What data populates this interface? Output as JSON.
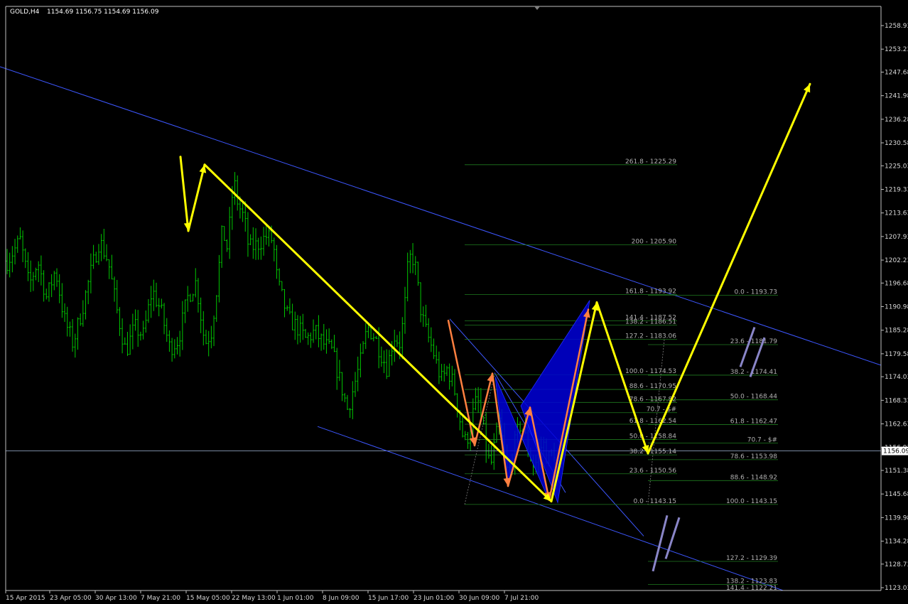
{
  "window": {
    "title": "GOLD,H4",
    "ohlc": "1154.69 1156.75 1154.69 1156.09"
  },
  "colors": {
    "background": "#000000",
    "candle": "#00c800",
    "trendline": "#3d57ff",
    "projection": "#ffff00",
    "harmonic": "#ff8040",
    "pattern_fill": "#0000d8",
    "fibo": "#1f7a1f",
    "fibo_text": "#b0b0b0",
    "price_tag_bg": "#ffffff"
  },
  "chart_data": {
    "type": "candlestick",
    "symbol": "GOLD",
    "timeframe": "H4",
    "ylim": [
      1120.0,
      1264.0
    ],
    "y_ticks": [
      "1258.93",
      "1253.23",
      "1247.68",
      "1241.98",
      "1236.28",
      "1230.58",
      "1225.03",
      "1219.33",
      "1213.63",
      "1207.93",
      "1202.23",
      "1196.68",
      "1190.98",
      "1185.28",
      "1179.58",
      "1174.03",
      "1168.33",
      "1162.63",
      "1156.93",
      "1151.38",
      "1145.68",
      "1139.98",
      "1134.28",
      "1128.73",
      "1123.03"
    ],
    "y_tick_values": [
      1258.93,
      1253.23,
      1247.68,
      1241.98,
      1236.28,
      1230.58,
      1225.03,
      1219.33,
      1213.63,
      1207.93,
      1202.23,
      1196.68,
      1190.98,
      1185.28,
      1179.58,
      1174.03,
      1168.33,
      1162.63,
      1156.93,
      1151.38,
      1145.68,
      1139.98,
      1134.28,
      1128.73,
      1123.03
    ],
    "x_ticks": [
      "15 Apr 2015",
      "23 Apr 05:00",
      "30 Apr 13:00",
      "7 May 21:00",
      "15 May 05:00",
      "22 May 13:00",
      "1 Jun 01:00",
      "8 Jun 09:00",
      "15 Jun 17:00",
      "23 Jun 01:00",
      "30 Jun 09:00",
      "7 Jul 21:00"
    ],
    "bar_count": 210,
    "last_price": 1156.09,
    "last_price_label": "1156.09",
    "close_path": [
      [
        0,
        1202
      ],
      [
        6,
        1207
      ],
      [
        10,
        1196
      ],
      [
        14,
        1202
      ],
      [
        18,
        1193
      ],
      [
        22,
        1200
      ],
      [
        26,
        1188
      ],
      [
        30,
        1182
      ],
      [
        34,
        1190
      ],
      [
        38,
        1199
      ],
      [
        42,
        1207
      ],
      [
        46,
        1202
      ],
      [
        50,
        1190
      ],
      [
        54,
        1180
      ],
      [
        58,
        1186
      ],
      [
        62,
        1184
      ],
      [
        66,
        1195
      ],
      [
        70,
        1190
      ],
      [
        74,
        1181
      ],
      [
        78,
        1183
      ],
      [
        82,
        1193
      ],
      [
        86,
        1197
      ],
      [
        90,
        1182
      ],
      [
        93,
        1185
      ],
      [
        96,
        1198
      ],
      [
        98,
        1210
      ],
      [
        100,
        1205
      ],
      [
        102,
        1214
      ],
      [
        103,
        1222
      ],
      [
        105,
        1216
      ],
      [
        108,
        1212
      ],
      [
        110,
        1205
      ],
      [
        114,
        1206
      ],
      [
        118,
        1208
      ],
      [
        121,
        1207
      ],
      [
        123,
        1197
      ],
      [
        128,
        1188
      ],
      [
        132,
        1186
      ],
      [
        136,
        1183
      ],
      [
        140,
        1185
      ],
      [
        144,
        1182
      ],
      [
        148,
        1180
      ],
      [
        151,
        1174
      ],
      [
        153,
        1170
      ],
      [
        155,
        1166
      ],
      [
        158,
        1172
      ],
      [
        161,
        1178
      ],
      [
        164,
        1186
      ],
      [
        167,
        1184
      ],
      [
        170,
        1180
      ],
      [
        173,
        1176
      ],
      [
        176,
        1184
      ],
      [
        179,
        1182
      ],
      [
        181,
        1191
      ],
      [
        182,
        1199
      ],
      [
        184,
        1204
      ],
      [
        186,
        1200
      ],
      [
        188,
        1191
      ],
      [
        190,
        1186
      ],
      [
        192,
        1183
      ],
      [
        194,
        1180
      ],
      [
        196,
        1176
      ],
      [
        198,
        1173
      ],
      [
        200,
        1176
      ],
      [
        202,
        1174
      ],
      [
        204,
        1170
      ],
      [
        206,
        1164
      ],
      [
        208,
        1158
      ],
      [
        210,
        1160
      ],
      [
        212,
        1165
      ],
      [
        214,
        1169
      ],
      [
        216,
        1163
      ],
      [
        218,
        1157
      ],
      [
        220,
        1152
      ],
      [
        222,
        1158
      ],
      [
        224,
        1163
      ],
      [
        226,
        1156
      ],
      [
        228,
        1150
      ],
      [
        230,
        1155
      ],
      [
        232,
        1160
      ],
      [
        234,
        1163
      ],
      [
        236,
        1159
      ],
      [
        238,
        1155
      ],
      [
        240,
        1152
      ],
      [
        242,
        1156
      ],
      [
        244,
        1158
      ],
      [
        246,
        1154
      ],
      [
        248,
        1155
      ],
      [
        249,
        1156.09
      ]
    ],
    "channel_lines": [
      {
        "name": "upper-channel",
        "points": [
          [
            0,
            1249.0
          ],
          [
            1278,
            1174.6
          ]
        ]
      },
      {
        "name": "lower-channel",
        "points": [
          [
            447,
            1162.0
          ],
          [
            1136,
            1120.3
          ]
        ]
      },
      {
        "name": "inner-channel-top",
        "points": [
          [
            633,
            1188.0
          ],
          [
            906,
            1135.5
          ]
        ]
      },
      {
        "name": "inner-channel-mid",
        "points": [
          [
            696,
            1175.0
          ],
          [
            796,
            1146.0
          ]
        ]
      }
    ],
    "projection_path": [
      [
        254,
        1227.2
      ],
      [
        265,
        1209.3
      ],
      [
        288,
        1225.3
      ],
      [
        776,
        1143.9
      ],
      [
        840,
        1192.0
      ],
      [
        912,
        1155.5
      ],
      [
        1140,
        1244.8
      ]
    ],
    "harmonic_path": [
      [
        631,
        1187.6
      ],
      [
        668,
        1157.4
      ],
      [
        693,
        1174.8
      ],
      [
        715,
        1147.6
      ],
      [
        746,
        1166.6
      ],
      [
        773,
        1144.2
      ],
      [
        828,
        1190.3
      ]
    ],
    "pattern_triangles": [
      [
        [
          697,
          1174.0
        ],
        [
          715,
          1147.8
        ],
        [
          746,
          1166.4
        ],
        [
          773,
          1144.0
        ]
      ],
      [
        [
          733,
          1167.0
        ],
        [
          830,
          1192.5
        ],
        [
          785,
          1143.6
        ]
      ]
    ],
    "fib_levels_left": [
      {
        "label": "261.8 - 1225.29",
        "price": 1225.29,
        "x1": 654,
        "x2": 953
      },
      {
        "label": "200 - 1205.90",
        "price": 1205.9,
        "x1": 654,
        "x2": 953
      },
      {
        "label": "161.8 - 1193.92",
        "price": 1193.92,
        "x1": 654,
        "x2": 953
      },
      {
        "label": "141.4 - 1187.52",
        "price": 1187.52,
        "x1": 654,
        "x2": 953
      },
      {
        "label": "138.2 - 1186.51",
        "price": 1186.51,
        "x1": 654,
        "x2": 953
      },
      {
        "label": "127.2 - 1183.06",
        "price": 1183.06,
        "x1": 654,
        "x2": 953
      },
      {
        "label": "100.0 - 1174.53",
        "price": 1174.53,
        "x1": 654,
        "x2": 953
      },
      {
        "label": "88.6 - 1170.95",
        "price": 1170.95,
        "x1": 654,
        "x2": 953
      },
      {
        "label": "78.6 - 1167.82",
        "price": 1167.82,
        "x1": 654,
        "x2": 953
      },
      {
        "label": "70.7 - $#",
        "price": 1165.34,
        "x1": 654,
        "x2": 953
      },
      {
        "label": "61.8 - 1162.54",
        "price": 1162.54,
        "x1": 654,
        "x2": 953
      },
      {
        "label": "50.0 - 1158.84",
        "price": 1158.84,
        "x1": 654,
        "x2": 953
      },
      {
        "label": "38.2 - 1155.14",
        "price": 1155.14,
        "x1": 654,
        "x2": 953
      },
      {
        "label": "23.6 - 1150.56",
        "price": 1150.56,
        "x1": 654,
        "x2": 953
      },
      {
        "label": "0.0 - 1143.15",
        "price": 1143.15,
        "x1": 654,
        "x2": 953
      }
    ],
    "fib_levels_right": [
      {
        "label": "0.0 - 1193.73",
        "price": 1193.73,
        "x1": 912,
        "x2": 1095
      },
      {
        "label": "23.6 - 1181.79",
        "price": 1181.79,
        "x1": 912,
        "x2": 1095
      },
      {
        "label": "38.2 - 1174.41",
        "price": 1174.41,
        "x1": 912,
        "x2": 1095
      },
      {
        "label": "50.0 - 1168.44",
        "price": 1168.44,
        "x1": 912,
        "x2": 1095
      },
      {
        "label": "61.8 - 1162.47",
        "price": 1162.47,
        "x1": 912,
        "x2": 1095
      },
      {
        "label": "70.7 - $#",
        "price": 1157.97,
        "x1": 912,
        "x2": 1095
      },
      {
        "label": "78.6 - 1153.98",
        "price": 1153.98,
        "x1": 912,
        "x2": 1095
      },
      {
        "label": "88.6 - 1148.92",
        "price": 1148.92,
        "x1": 912,
        "x2": 1095
      },
      {
        "label": "100.0 - 1143.15",
        "price": 1143.15,
        "x1": 912,
        "x2": 1095
      },
      {
        "label": "127.2 - 1129.39",
        "price": 1129.39,
        "x1": 912,
        "x2": 1095
      },
      {
        "label": "138.2 - 1123.83",
        "price": 1123.83,
        "x1": 912,
        "x2": 1095
      },
      {
        "label": "141.4 - 1122.21",
        "price": 1122.21,
        "x1": 912,
        "x2": 1095
      }
    ],
    "slash_marks": [
      [
        [
          1042,
          1176.4
        ],
        [
          1062,
          1186.0
        ]
      ],
      [
        [
          1056,
          1174.0
        ],
        [
          1076,
          1183.5
        ]
      ],
      [
        [
          919,
          1127.0
        ],
        [
          939,
          1140.5
        ]
      ],
      [
        [
          937,
          1130.0
        ],
        [
          956,
          1140.0
        ]
      ]
    ]
  }
}
